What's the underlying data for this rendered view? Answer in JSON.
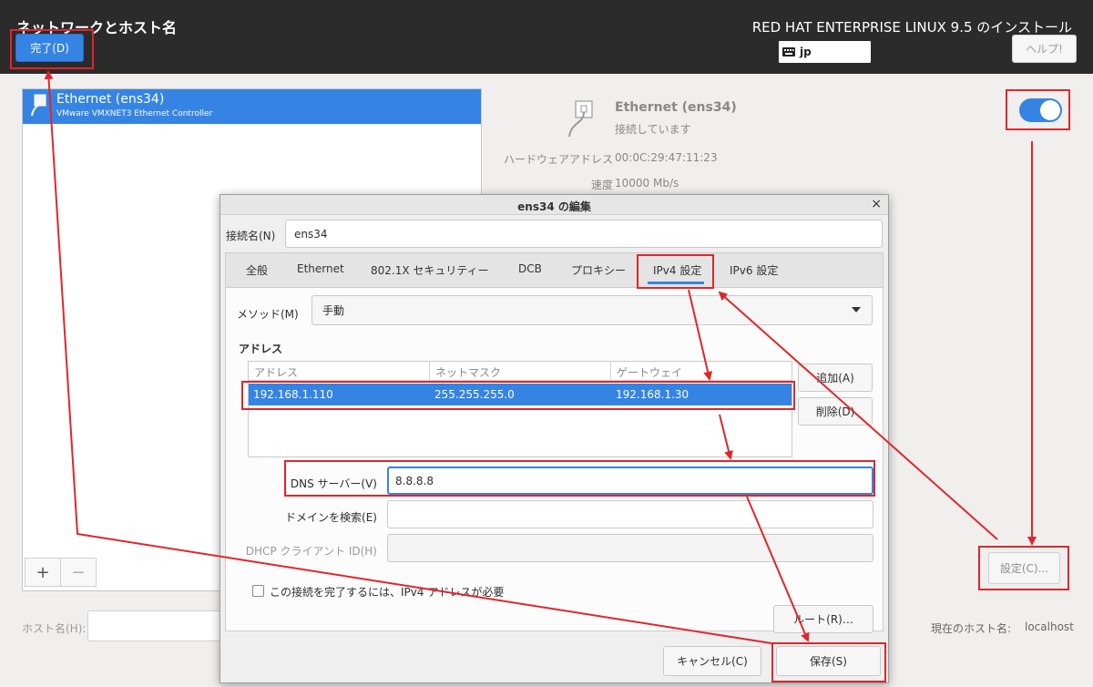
{
  "header": {
    "page_title": "ネットワークとホスト名",
    "done_label": "完了(D)",
    "product_title": "RED HAT ENTERPRISE LINUX 9.5 のインストール",
    "keyboard_layout": "jp",
    "help_label": "ヘルプ!"
  },
  "device_list": {
    "items": [
      {
        "name": "Ethernet (ens34)",
        "description": "VMware VMXNET3 Ethernet Controller"
      }
    ],
    "add_label": "+",
    "remove_label": "−"
  },
  "device_detail": {
    "name": "Ethernet (ens34)",
    "status": "接続しています",
    "hardware_address_label": "ハードウェアアドレス",
    "hardware_address": "00:0C:29:47:11:23",
    "speed_label": "速度",
    "speed": "10000 Mb/s",
    "configure_label": "設定(C)..."
  },
  "hostname": {
    "label": "ホスト名(H):",
    "current_label": "現在のホスト名:",
    "current_value": "localhost"
  },
  "dialog": {
    "title": "ens34 の編集",
    "close_label": "×",
    "connection_name_label": "接続名(N)",
    "connection_name": "ens34",
    "tabs": [
      "全般",
      "Ethernet",
      "802.1X セキュリティー",
      "DCB",
      "プロキシー",
      "IPv4 設定",
      "IPv6 設定"
    ],
    "active_tab": "IPv4 設定",
    "method_label": "メソッド(M)",
    "method_value": "手動",
    "address_section": "アドレス",
    "address_columns": [
      "アドレス",
      "ネットマスク",
      "ゲートウェイ"
    ],
    "addresses": [
      {
        "address": "192.168.1.110",
        "netmask": "255.255.255.0",
        "gateway": "192.168.1.30"
      }
    ],
    "add_label": "追加(A)",
    "delete_label": "削除(D)",
    "dns_label": "DNS サーバー(V)",
    "dns_value": "8.8.8.8",
    "search_domain_label": "ドメインを検索(E)",
    "search_domain_value": "",
    "dhcp_client_id_label": "DHCP クライアント ID(H)",
    "dhcp_client_id_value": "",
    "require_ipv4_label": "この接続を完了するには、IPv4 アドレスが必要",
    "routes_label": "ルート(R)…",
    "cancel_label": "キャンセル(C)",
    "save_label": "保存(S)"
  },
  "colors": {
    "accent": "#3584e4",
    "header_bg": "#2b2b2b",
    "annotation": "#e0262b"
  }
}
